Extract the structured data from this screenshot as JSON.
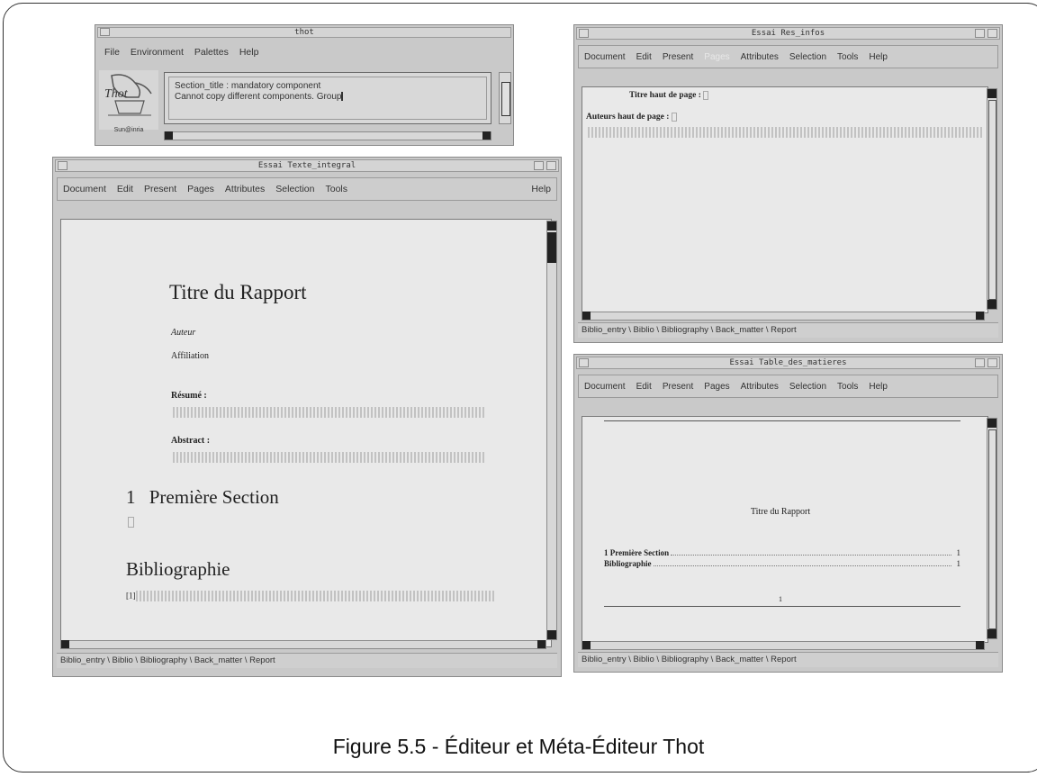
{
  "caption": "Figure 5.5 - Éditeur et Méta-Éditeur Thot",
  "thot_window": {
    "title": "thot",
    "menu": [
      "File",
      "Environment",
      "Palettes",
      "Help"
    ],
    "logo_text": "Thot",
    "logo_sub": "Sun@inria",
    "messages": [
      "Section_title : mandatory component",
      "Cannot copy different components. Group"
    ]
  },
  "texte_window": {
    "title": "Essai  Texte_integral",
    "menu": [
      "Document",
      "Edit",
      "Present",
      "Pages",
      "Attributes",
      "Selection",
      "Tools"
    ],
    "help": "Help",
    "doc_title": "Titre du Rapport",
    "author": "Auteur",
    "affiliation": "Affiliation",
    "resume_label": "Résumé :",
    "abstract_label": "Abstract :",
    "section_number": "1",
    "section_title": "Première Section",
    "biblio_title": "Bibliographie",
    "biblio_ref": "[1]",
    "status": "Biblio_entry \\ Biblio \\ Bibliography \\ Back_matter \\ Report"
  },
  "resinfos_window": {
    "title": "Essai  Res_infos",
    "menu": [
      "Document",
      "Edit",
      "Present",
      "Pages",
      "Attributes",
      "Selection",
      "Tools"
    ],
    "help": "Help",
    "line1": "Titre haut de page :",
    "line2": "Auteurs haut de page :",
    "status": "Biblio_entry \\ Biblio \\ Bibliography \\ Back_matter \\ Report"
  },
  "table_window": {
    "title": "Essai  Table_des_matieres",
    "menu": [
      "Document",
      "Edit",
      "Present",
      "Pages",
      "Attributes",
      "Selection",
      "Tools"
    ],
    "help": "Help",
    "doc_title": "Titre du Rapport",
    "toc": [
      {
        "label": "1  Première Section",
        "page": "1"
      },
      {
        "label": "Bibliographie",
        "page": "1"
      }
    ],
    "page_number": "1",
    "status": "Biblio_entry \\ Biblio \\ Bibliography \\ Back_matter \\ Report"
  }
}
